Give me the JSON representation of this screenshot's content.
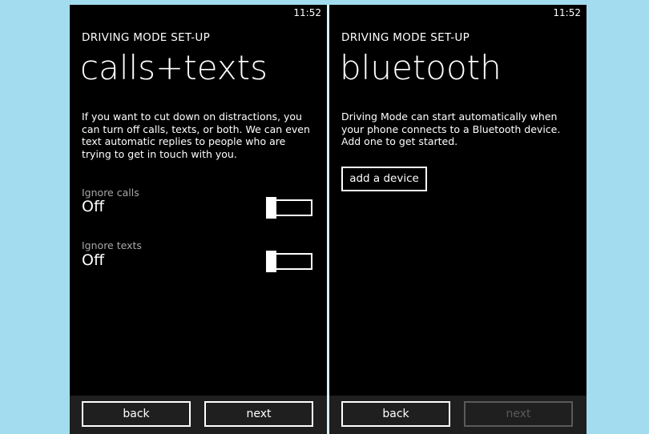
{
  "left": {
    "time": "11:52",
    "kicker": "DRIVING MODE SET-UP",
    "title": "calls+texts",
    "description": "If you want to cut down on distractions, you can turn off calls, texts, or both. We can even text automatic replies to people who are trying to get in touch with you.",
    "settings": [
      {
        "label": "Ignore calls",
        "value": "Off",
        "enabled": false
      },
      {
        "label": "Ignore texts",
        "value": "Off",
        "enabled": false
      }
    ],
    "buttons": {
      "back": "back",
      "next": "next"
    }
  },
  "right": {
    "time": "11:52",
    "kicker": "DRIVING MODE SET-UP",
    "title": "bluetooth",
    "description": "Driving Mode can start automatically when your phone connects to a Bluetooth device. Add one to get started.",
    "add_device": "add a device",
    "buttons": {
      "back": "back",
      "next": "next",
      "next_disabled": true
    }
  },
  "colors": {
    "background": "#a3dcee",
    "screen": "#000000",
    "app_bar": "#1f1f1f",
    "muted_text": "#a8a8a8",
    "disabled": "#5a5a5a"
  }
}
